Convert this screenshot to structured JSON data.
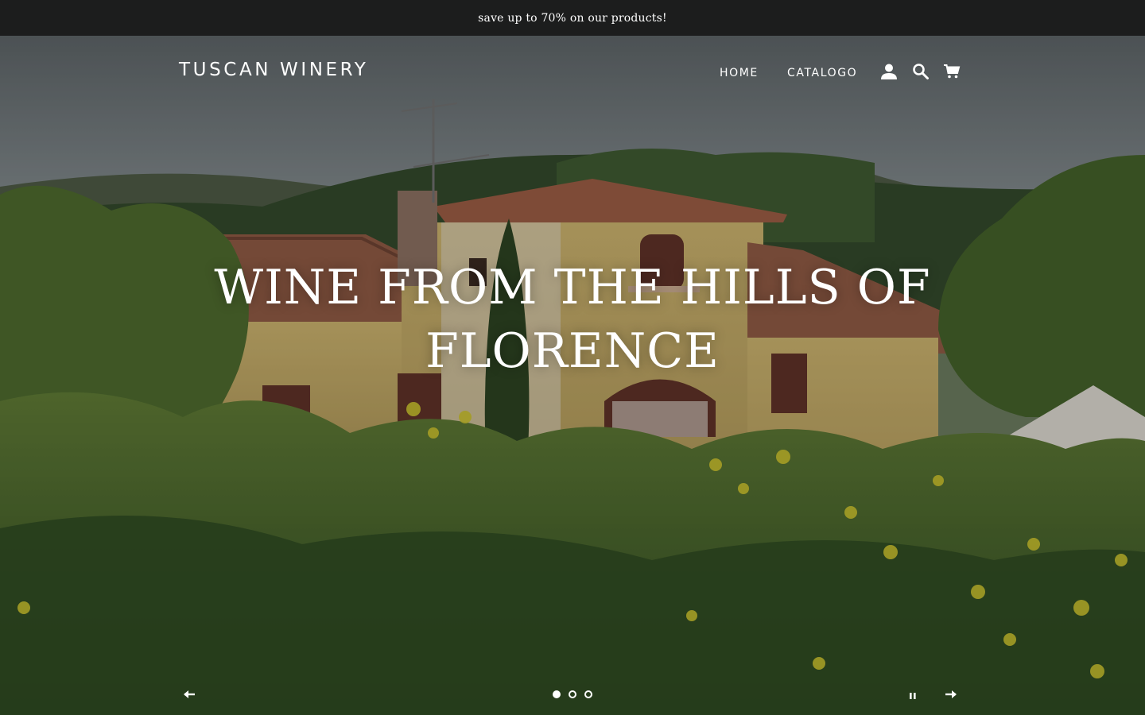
{
  "announcement": {
    "text": "save up to 70% on our products!"
  },
  "header": {
    "logo": "TUSCAN WINERY",
    "nav": [
      {
        "label": "HOME"
      },
      {
        "label": "CATALOGO"
      }
    ],
    "icons": [
      "account-icon",
      "search-icon",
      "cart-icon"
    ]
  },
  "hero": {
    "title": "WINE FROM THE HILLS OF FLORENCE",
    "slides_total": 3,
    "active_slide": 1,
    "controls": [
      "arrow-left-icon",
      "pause-icon",
      "arrow-right-icon"
    ]
  },
  "colors": {
    "announcement_bg": "#1c1d1d",
    "text": "#ffffff"
  }
}
